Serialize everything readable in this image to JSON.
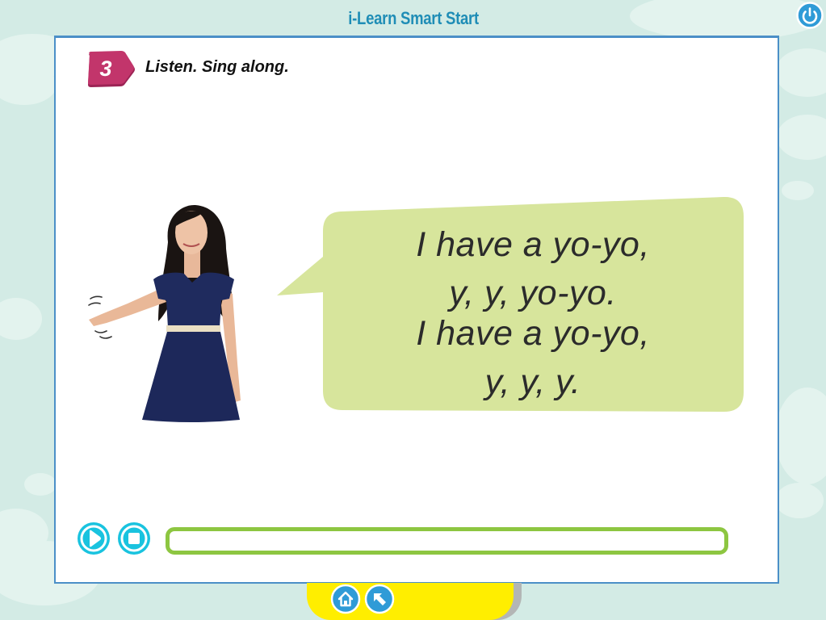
{
  "app": {
    "title": "i-Learn Smart Start"
  },
  "exercise": {
    "number": "3",
    "instruction": "Listen. Sing along."
  },
  "lyrics": [
    "I have a yo-yo,",
    "y, y, yo-yo.",
    "I have a yo-yo,",
    "y, y, y."
  ],
  "player": {
    "play_icon": "play-icon",
    "stop_icon": "stop-icon",
    "progress": 0
  },
  "nav": {
    "home_icon": "home-icon",
    "back_icon": "back-arrow-icon",
    "power_icon": "power-icon"
  },
  "colors": {
    "background": "#d3ebe5",
    "title": "#1f8db6",
    "badge": "#c2356b",
    "bubble": "#d7e59c",
    "progress_border": "#8dc641",
    "player_buttons": "#19c3df",
    "nav_buttons": "#2f9bd7",
    "bottom_tab": "#ffee00"
  }
}
